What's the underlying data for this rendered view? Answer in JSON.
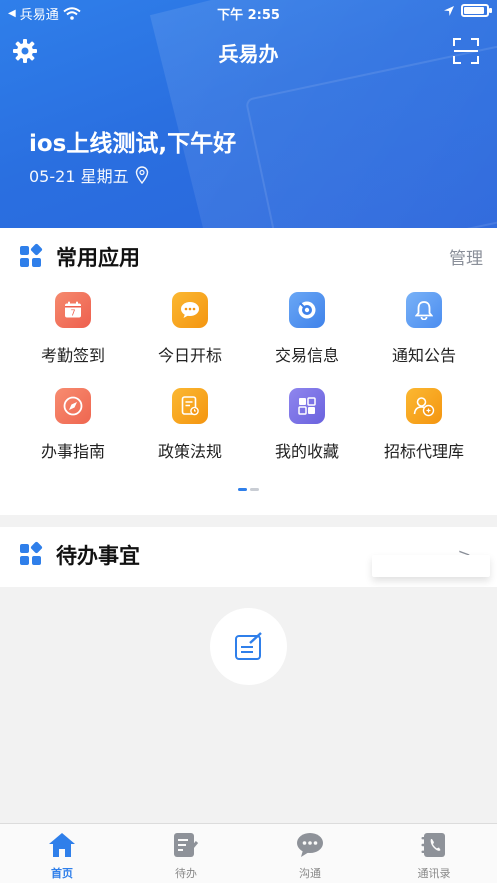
{
  "status_bar": {
    "back_app": "兵易通",
    "time": "下午 2:55",
    "battery_level": 0.9
  },
  "nav": {
    "title": "兵易办",
    "left_icon": "gear-icon",
    "right_icon": "scan-icon"
  },
  "hero": {
    "greeting": "ios上线测试,下午好",
    "date": "05-21 星期五"
  },
  "apps_section": {
    "title": "常用应用",
    "manage_label": "管理",
    "items": [
      {
        "label": "考勤签到",
        "icon": "calendar-icon",
        "color": "#f0715a"
      },
      {
        "label": "今日开标",
        "icon": "chat-icon",
        "color": "#f6a118"
      },
      {
        "label": "交易信息",
        "icon": "target-icon",
        "color": "#4a8ff0"
      },
      {
        "label": "通知公告",
        "icon": "bell-icon",
        "color": "#5b9df2"
      },
      {
        "label": "办事指南",
        "icon": "compass-icon",
        "color": "#f2785f"
      },
      {
        "label": "政策法规",
        "icon": "document-icon",
        "color": "#f6a118"
      },
      {
        "label": "我的收藏",
        "icon": "collection-icon",
        "color": "#7b74e6"
      },
      {
        "label": "招标代理库",
        "icon": "agent-icon",
        "color": "#f6a118"
      }
    ],
    "pager": {
      "pages": 2,
      "active": 0
    }
  },
  "todo_section": {
    "title": "待办事宜",
    "arrow": ">"
  },
  "tabbar": {
    "active_color": "#2f7fea",
    "items": [
      {
        "label": "首页",
        "icon": "home-icon"
      },
      {
        "label": "待办",
        "icon": "todo-icon"
      },
      {
        "label": "沟通",
        "icon": "message-icon"
      },
      {
        "label": "通讯录",
        "icon": "contacts-icon"
      }
    ]
  }
}
